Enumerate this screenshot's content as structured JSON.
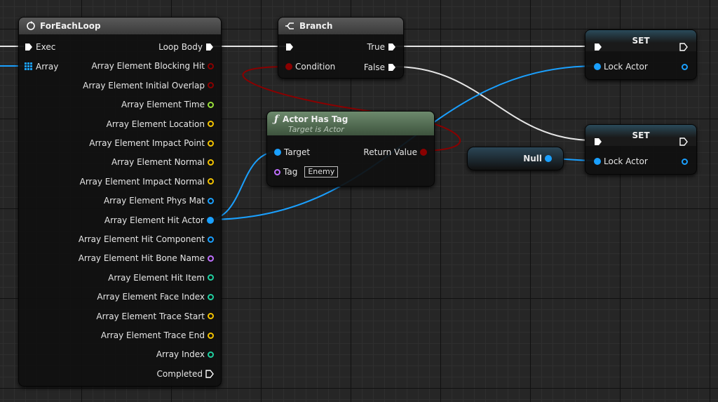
{
  "foreach": {
    "title": "ForEachLoop",
    "inputs": [
      {
        "label": "Exec",
        "type": "exec"
      },
      {
        "label": "Array",
        "type": "array"
      }
    ],
    "outputs": [
      {
        "label": "Loop Body",
        "type": "exec"
      },
      {
        "label": "Array Element Blocking Hit",
        "color": "#8a0000",
        "filled": false
      },
      {
        "label": "Array Element Initial Overlap",
        "color": "#8a0000",
        "filled": false
      },
      {
        "label": "Array Element Time",
        "color": "#9ae03a",
        "filled": false
      },
      {
        "label": "Array Element Location",
        "color": "#f2c200",
        "filled": false
      },
      {
        "label": "Array Element Impact Point",
        "color": "#f2c200",
        "filled": false
      },
      {
        "label": "Array Element Normal",
        "color": "#f2c200",
        "filled": false
      },
      {
        "label": "Array Element Impact Normal",
        "color": "#f2c200",
        "filled": false
      },
      {
        "label": "Array Element Phys Mat",
        "color": "#1aa0ff",
        "filled": false
      },
      {
        "label": "Array Element Hit Actor",
        "color": "#1aa0ff",
        "filled": true
      },
      {
        "label": "Array Element Hit Component",
        "color": "#1aa0ff",
        "filled": false
      },
      {
        "label": "Array Element Hit Bone Name",
        "color": "#c070ff",
        "filled": false
      },
      {
        "label": "Array Element Hit Item",
        "color": "#20d0a0",
        "filled": false
      },
      {
        "label": "Array Element Face Index",
        "color": "#20d0a0",
        "filled": false
      },
      {
        "label": "Array Element Trace Start",
        "color": "#f2c200",
        "filled": false
      },
      {
        "label": "Array Element Trace End",
        "color": "#f2c200",
        "filled": false
      },
      {
        "label": "Array Index",
        "color": "#20d0a0",
        "filled": false
      },
      {
        "label": "Completed",
        "type": "exec-hollow"
      }
    ]
  },
  "branch": {
    "title": "Branch",
    "condition": "Condition",
    "true_label": "True",
    "false_label": "False"
  },
  "actor_has_tag": {
    "title": "Actor Has Tag",
    "subtitle": "Target is Actor",
    "target": "Target",
    "tag": "Tag",
    "tag_value": "Enemy",
    "return_value": "Return Value"
  },
  "set1": {
    "title": "SET",
    "var": "Lock Actor"
  },
  "set2": {
    "title": "SET",
    "var": "Lock Actor"
  },
  "null_node": {
    "label": "Null"
  },
  "colors": {
    "exec": "#ffffff",
    "object": "#1aa0ff",
    "bool": "#8a0000",
    "fn_header": "#5a775a"
  }
}
